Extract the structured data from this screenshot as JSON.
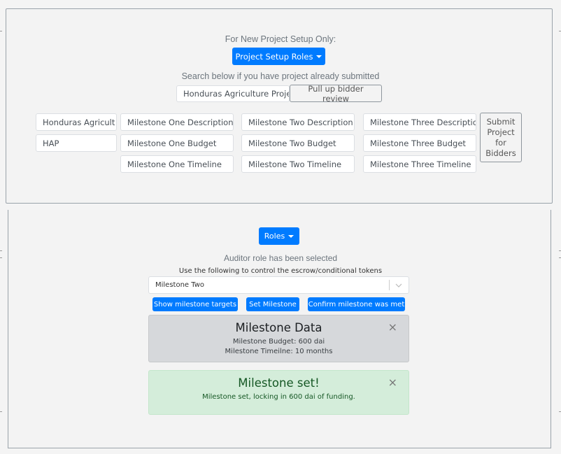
{
  "setup": {
    "intro_text": "For New Project Setup Only:",
    "setup_roles_button": "Project Setup Roles",
    "search_hint": "Search below if you have project already submitted",
    "search_input_value": "Honduras Agriculture Proje",
    "pull_up_button": "Pull up bidder review"
  },
  "form": {
    "project_name_value": "Honduras Agricult",
    "project_code_value": "HAP",
    "milestone_one": {
      "description": "Milestone One Description",
      "budget": "Milestone One Budget",
      "timeline": "Milestone One Timeline"
    },
    "milestone_two": {
      "description": "Milestone Two Description",
      "budget": "Milestone Two Budget",
      "timeline": "Milestone Two Timeline"
    },
    "milestone_three": {
      "description": "Milestone Three Descriptio",
      "budget": "Milestone Three Budget",
      "timeline": "Milestone Three Timeline"
    },
    "submit_lines": [
      "Submit",
      "Project",
      "for",
      "Bidders"
    ]
  },
  "auditor": {
    "roles_button": "Roles",
    "role_status": "Auditor role has been selected",
    "instructions": "Use the following to control the escrow/conditional tokens",
    "milestone_select_value": "Milestone Two",
    "show_targets_button": "Show milestone targets",
    "set_milestone_button": "Set Milestone",
    "confirm_button": "Confirm milestone was met"
  },
  "milestone_data_alert": {
    "title": "Milestone Data",
    "budget_line": "Milestone Budget: 600 dai",
    "timeline_line": "Milestone Timeilne: 10 months",
    "close": "×"
  },
  "milestone_set_alert": {
    "title": "Milestone set!",
    "message": "Milestone set, locking in 600 dai of funding.",
    "close": "×"
  },
  "colors": {
    "primary": "#007bff",
    "background": "#f4f4f4",
    "info_alert_bg": "#d6d8db",
    "success_alert_bg": "#d4edda",
    "success_text": "#155724"
  }
}
